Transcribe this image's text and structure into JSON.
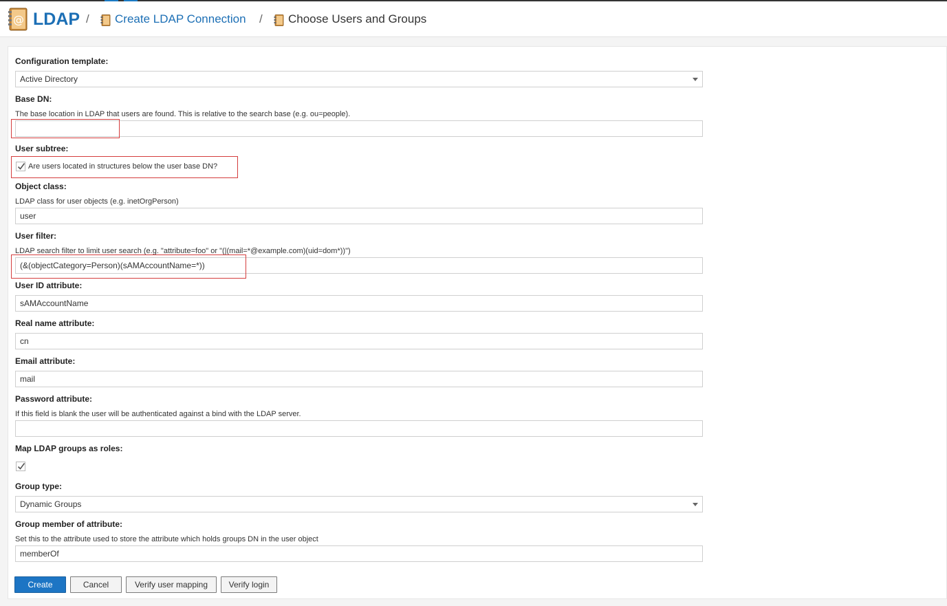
{
  "header": {
    "app_title": "LDAP",
    "separator": "/",
    "breadcrumbs": [
      "Create LDAP Connection",
      "Choose Users and Groups"
    ]
  },
  "form": {
    "config_template": {
      "label": "Configuration template:",
      "value": "Active Directory"
    },
    "base_dn": {
      "label": "Base DN:",
      "description": "The base location in LDAP that users are found. This is relative to the search base (e.g. ou=people).",
      "value": ""
    },
    "user_subtree": {
      "label": "User subtree:",
      "checkbox_label": "Are users located in structures below the user base DN?",
      "checked": true
    },
    "object_class": {
      "label": "Object class:",
      "description": "LDAP class for user objects (e.g. inetOrgPerson)",
      "value": "user"
    },
    "user_filter": {
      "label": "User filter:",
      "description": "LDAP search filter to limit user search (e.g. \"attribute=foo\" or \"(|(mail=*@example.com)(uid=dom*))\")",
      "value": "(&(objectCategory=Person)(sAMAccountName=*))"
    },
    "user_id_attr": {
      "label": "User ID attribute:",
      "value": "sAMAccountName"
    },
    "real_name_attr": {
      "label": "Real name attribute:",
      "value": "cn"
    },
    "email_attr": {
      "label": "Email attribute:",
      "value": "mail"
    },
    "password_attr": {
      "label": "Password attribute:",
      "description": "If this field is blank the user will be authenticated against a bind with the LDAP server.",
      "value": ""
    },
    "map_groups": {
      "label": "Map LDAP groups as roles:",
      "checked": true
    },
    "group_type": {
      "label": "Group type:",
      "value": "Dynamic Groups"
    },
    "group_member_attr": {
      "label": "Group member of attribute:",
      "description": "Set this to the attribute used to store the attribute which holds groups DN in the user object",
      "value": "memberOf"
    }
  },
  "buttons": {
    "create": "Create",
    "cancel": "Cancel",
    "verify_mapping": "Verify user mapping",
    "verify_login": "Verify login"
  },
  "colors": {
    "accent": "#1c6fb5",
    "primary_button": "#1d75c4",
    "highlight_box": "#d43c3c"
  }
}
